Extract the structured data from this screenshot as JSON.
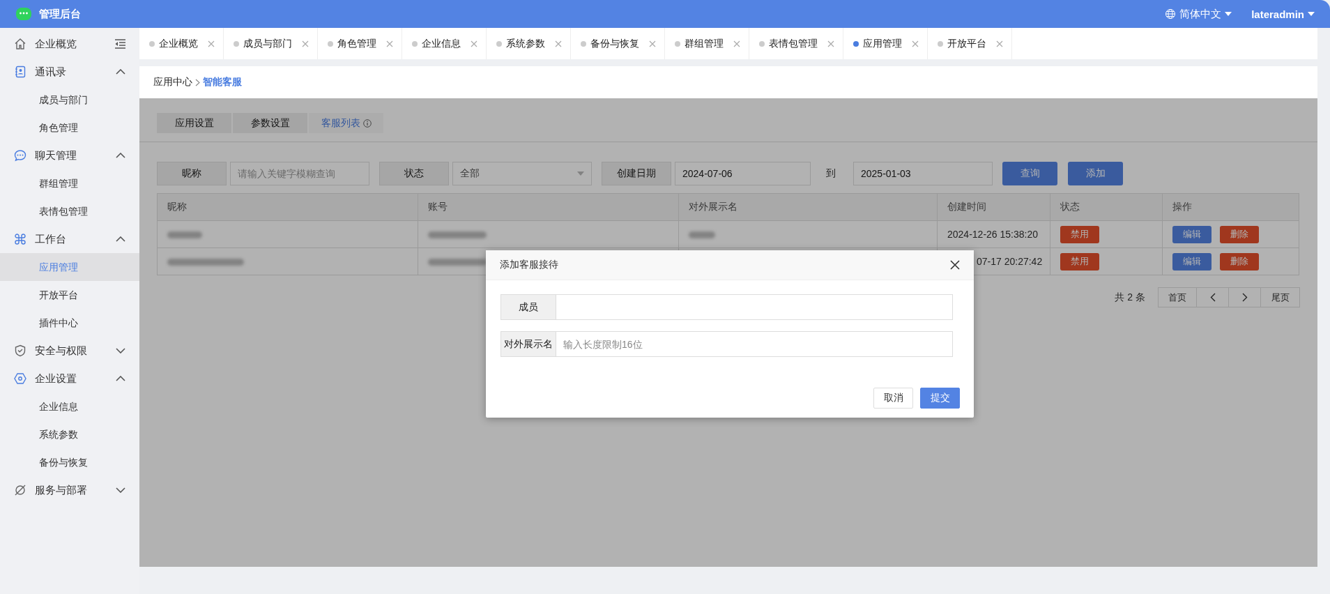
{
  "header": {
    "app_title": "管理后台",
    "language": "简体中文",
    "user": "lateradmin"
  },
  "sidebar": {
    "items": [
      {
        "label": "企业概览",
        "selected": false
      },
      {
        "label": "通讯录",
        "selected": false,
        "expanded": true,
        "children": [
          {
            "label": "成员与部门",
            "selected": false
          },
          {
            "label": "角色管理",
            "selected": false
          }
        ]
      },
      {
        "label": "聊天管理",
        "selected": false,
        "expanded": true,
        "children": [
          {
            "label": "群组管理",
            "selected": false
          },
          {
            "label": "表情包管理",
            "selected": false
          }
        ]
      },
      {
        "label": "工作台",
        "selected": false,
        "expanded": true,
        "children": [
          {
            "label": "应用管理",
            "selected": true
          },
          {
            "label": "开放平台",
            "selected": false
          },
          {
            "label": "插件中心",
            "selected": false
          }
        ]
      },
      {
        "label": "安全与权限",
        "selected": false,
        "expanded": false
      },
      {
        "label": "企业设置",
        "selected": false,
        "expanded": true,
        "children": [
          {
            "label": "企业信息",
            "selected": false
          },
          {
            "label": "系统参数",
            "selected": false
          },
          {
            "label": "备份与恢复",
            "selected": false
          }
        ]
      },
      {
        "label": "服务与部署",
        "selected": false,
        "expanded": false
      }
    ]
  },
  "tabs": [
    {
      "label": "企业概览",
      "selected": false
    },
    {
      "label": "成员与部门",
      "selected": false
    },
    {
      "label": "角色管理",
      "selected": false
    },
    {
      "label": "企业信息",
      "selected": false
    },
    {
      "label": "系统参数",
      "selected": false
    },
    {
      "label": "备份与恢复",
      "selected": false
    },
    {
      "label": "群组管理",
      "selected": false
    },
    {
      "label": "表情包管理",
      "selected": false
    },
    {
      "label": "应用管理",
      "selected": true
    },
    {
      "label": "开放平台",
      "selected": false
    }
  ],
  "breadcrumb": [
    {
      "label": "应用中心",
      "current": false
    },
    {
      "label": "智能客服",
      "current": true
    }
  ],
  "sub_tabs": [
    {
      "label": "应用设置",
      "selected": false
    },
    {
      "label": "参数设置",
      "selected": false
    },
    {
      "label": "客服列表",
      "selected": true
    }
  ],
  "filters": {
    "nickname": {
      "label": "昵称",
      "placeholder": "请输入关键字模糊查询"
    },
    "status": {
      "label": "状态",
      "value": "全部"
    },
    "date": {
      "label": "创建日期",
      "from": "2024-07-06",
      "to_label": "到",
      "to": "2025-01-03"
    },
    "buttons": [
      "查询",
      "添加"
    ]
  },
  "table": {
    "columns": [
      "昵称",
      "账号",
      "对外展示名",
      "创建时间",
      "状态",
      "操作"
    ],
    "rows": [
      {
        "cells": [
          {
            "blurred": true
          },
          {
            "blurred": true
          },
          {
            "blurred": true
          },
          {
            "text": "2024-12-26 15:38:20"
          }
        ],
        "status": "禁用",
        "actions": [
          "编辑",
          "删除"
        ]
      },
      {
        "cells": [
          {
            "blurred": true
          },
          {
            "blurred": true
          },
          {
            "blurred": false
          },
          {
            "text": "07-17 20:27:42",
            "covered": true
          }
        ],
        "status": "禁用",
        "actions": [
          "编辑",
          "删除"
        ]
      }
    ]
  },
  "pagination": {
    "total": "共 2 条",
    "pages": [
      {
        "kind": "text",
        "label": "首页"
      },
      {
        "kind": "prev"
      },
      {
        "kind": "next"
      },
      {
        "kind": "text",
        "label": "尾页"
      }
    ]
  },
  "dialog": {
    "title": "添加客服接待",
    "fields": [
      {
        "label": "成员"
      },
      {
        "label": "对外展示名",
        "placeholder": "输入长度限制16位"
      }
    ],
    "buttons": [
      {
        "label": "取消",
        "kind": "default"
      },
      {
        "label": "提交",
        "kind": "primary"
      }
    ]
  }
}
